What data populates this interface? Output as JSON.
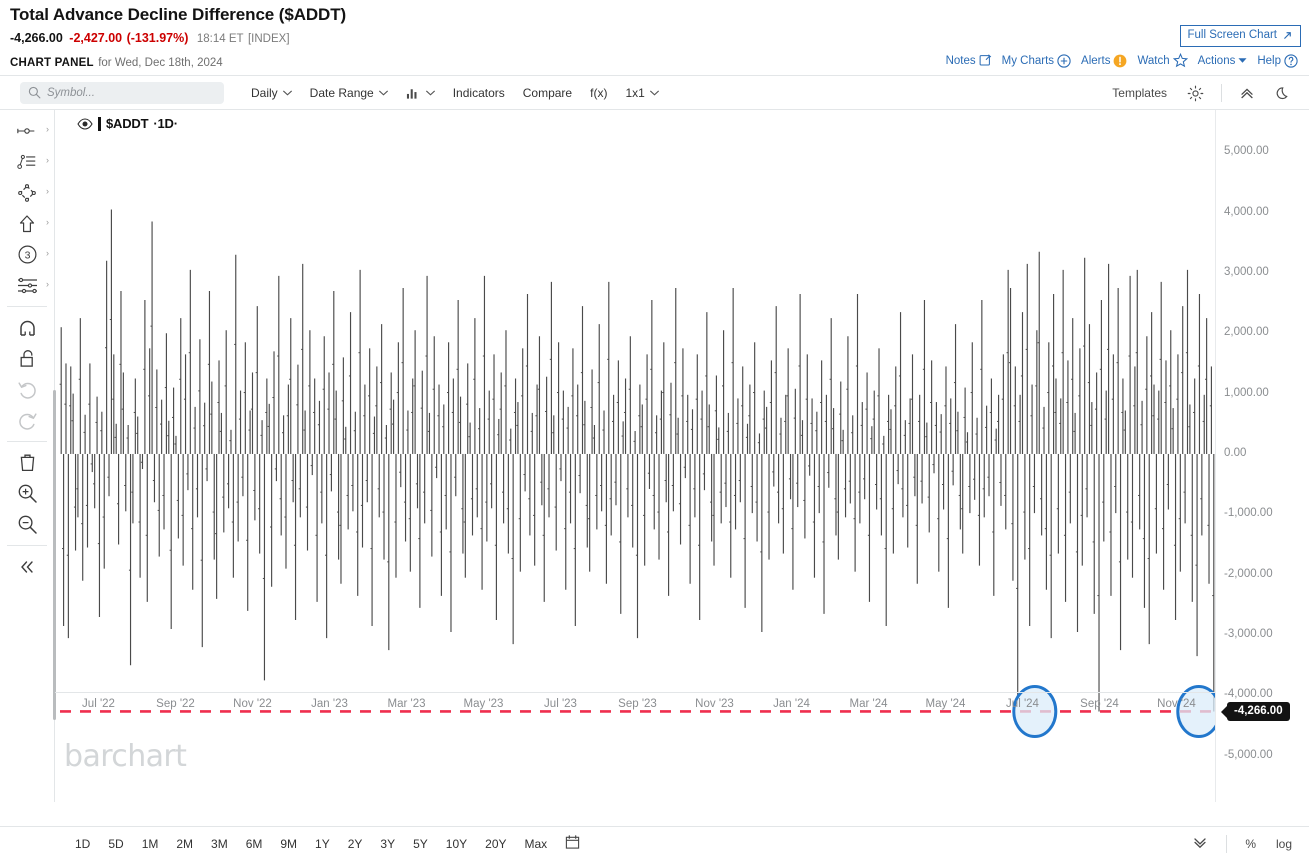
{
  "quote": {
    "title": "Total Advance Decline Difference ($ADDT)",
    "last": "-4,266.00",
    "change": "-2,427.00",
    "change_pct": "(-131.97%)",
    "time": "18:14 ET",
    "exchange": "[INDEX]",
    "change_color": "#cc0000"
  },
  "panel": {
    "label": "CHART PANEL",
    "for_text": " for Wed, Dec 18th, 2024",
    "full_screen_label": "Full Screen Chart",
    "links": [
      {
        "label": "Notes",
        "icon": "note-edit-icon"
      },
      {
        "label": "My Charts",
        "icon": "plus-circle-icon"
      },
      {
        "label": "Alerts",
        "icon": "alert-exclamation-icon"
      },
      {
        "label": "Watch",
        "icon": "star-icon"
      },
      {
        "label": "Actions",
        "icon": "caret-down-icon"
      },
      {
        "label": "Help",
        "icon": "question-circle-icon"
      }
    ]
  },
  "toolbar": {
    "search_placeholder": "Symbol...",
    "search_value": "",
    "items": [
      {
        "label": "Daily",
        "caret": true
      },
      {
        "label": "Date Range",
        "caret": true
      },
      {
        "label": "",
        "icon": "bar-chart-type-icon",
        "caret": true
      },
      {
        "label": "Indicators",
        "caret": false
      },
      {
        "label": "Compare",
        "caret": false
      },
      {
        "label": "f(x)",
        "caret": false
      },
      {
        "label": "1x1",
        "caret": true
      }
    ],
    "right": {
      "templates_label": "Templates",
      "settings_icon": "gear-icon",
      "collapse_icon": "chevron-up-double-icon",
      "theme_icon": "moon-icon"
    }
  },
  "tools": [
    {
      "name": "crosshair-line-tool",
      "icon": "line-dot-icon",
      "expandable": true,
      "dim": false
    },
    {
      "name": "annotation-list-tool",
      "icon": "trendline-list-icon",
      "expandable": true,
      "dim": false
    },
    {
      "name": "shapes-tool",
      "icon": "polygon-icon",
      "expandable": true,
      "dim": false
    },
    {
      "name": "arrow-tool",
      "icon": "arrow-up-icon",
      "expandable": true,
      "dim": false
    },
    {
      "name": "number-marker-tool",
      "icon": "circle-three-icon",
      "expandable": true,
      "dim": false
    },
    {
      "name": "fibonacci-tool",
      "icon": "fib-levels-icon",
      "expandable": true,
      "dim": false
    },
    {
      "name": "magnet-tool",
      "icon": "magnet-icon",
      "expandable": false,
      "dim": false
    },
    {
      "name": "lock-tool",
      "icon": "unlock-icon",
      "expandable": false,
      "dim": false
    },
    {
      "name": "undo-tool",
      "icon": "undo-icon",
      "expandable": false,
      "dim": true
    },
    {
      "name": "redo-tool",
      "icon": "redo-icon",
      "expandable": false,
      "dim": true
    },
    {
      "name": "delete-tool",
      "icon": "trash-icon",
      "expandable": false,
      "dim": false
    },
    {
      "name": "zoom-in-tool",
      "icon": "zoom-in-icon",
      "expandable": false,
      "dim": false
    },
    {
      "name": "zoom-out-tool",
      "icon": "zoom-out-icon",
      "expandable": false,
      "dim": false
    },
    {
      "name": "collapse-sidebar",
      "icon": "chevron-left-double-icon",
      "expandable": false,
      "dim": false
    }
  ],
  "legend": {
    "symbol": "$ADDT",
    "interval": "·1D·",
    "visibility_icon": "eye-icon"
  },
  "watermark": "barchart",
  "ranges": {
    "buttons": [
      "1D",
      "5D",
      "1M",
      "2M",
      "3M",
      "6M",
      "9M",
      "1Y",
      "2Y",
      "3Y",
      "5Y",
      "10Y",
      "20Y",
      "Max"
    ],
    "calendar_icon": "calendar-icon",
    "right": {
      "more_icon": "chevron-down-double-icon",
      "percent_label": "%",
      "log_label": "log"
    }
  },
  "annotations": {
    "price_line": {
      "value": -4266.0,
      "label": "-4,266.00",
      "color": "#ef2e4e",
      "style": "dashed"
    },
    "ellipses": [
      {
        "x_pct": 84.4,
        "value": -4266.0,
        "stroke": "#2277cc",
        "fill": "#dbecf9"
      },
      {
        "x_pct": 98.6,
        "value": -4266.0,
        "stroke": "#2277cc",
        "fill": "#dbecf9"
      }
    ]
  },
  "chart_data": {
    "type": "bar",
    "title": "Total Advance Decline Difference ($ADDT)",
    "subtitle": "$ADDT ·1D·",
    "xlabel": "",
    "ylabel": "",
    "ylim": [
      -5600,
      5400
    ],
    "yticks": [
      5000,
      4000,
      3000,
      2000,
      1000,
      0,
      -1000,
      -2000,
      -3000,
      -4000,
      -5000
    ],
    "ytick_labels": [
      "5,000.00",
      "4,000.00",
      "3,000.00",
      "2,000.00",
      "1,000.00",
      "0.00",
      "-1,000.00",
      "-2,000.00",
      "-3,000.00",
      "-4,000.00",
      "-5,000.00"
    ],
    "xticks": [
      "Jul '22",
      "Sep '22",
      "Nov '22",
      "Jan '23",
      "Mar '23",
      "May '23",
      "Jul '23",
      "Sep '23",
      "Nov '23",
      "Jan '24",
      "Mar '24",
      "May '24",
      "Jul '24",
      "Sep '24",
      "Nov '24"
    ],
    "grid": false,
    "legend_position": "top-left",
    "bar_color": "#4a4a4a",
    "zero_line": 0,
    "last_value": -4266.0,
    "values": [
      2100,
      -2850,
      1500,
      -3050,
      1450,
      1000,
      -1600,
      -1050,
      2250,
      -2100,
      650,
      -1550,
      1500,
      -300,
      -900,
      950,
      -2700,
      700,
      -1900,
      3200,
      -700,
      4050,
      1650,
      500,
      -1500,
      2700,
      1350,
      -950,
      480,
      -3500,
      -1150,
      1250,
      620,
      -2050,
      -250,
      2550,
      -2450,
      1750,
      3850,
      -800,
      1400,
      -1700,
      900,
      -1250,
      2000,
      550,
      -2900,
      1100,
      300,
      -1400,
      2250,
      -1850,
      1650,
      -600,
      3050,
      -2250,
      780,
      -1050,
      1900,
      -3200,
      850,
      -450,
      2700,
      1200,
      -1750,
      -2400,
      1550,
      680,
      -1300,
      2050,
      -900,
      400,
      -2050,
      3300,
      -1450,
      1050,
      -700,
      1850,
      -2600,
      720,
      1350,
      -1100,
      2450,
      -1650,
      560,
      -3750,
      1250,
      830,
      -2200,
      1700,
      -450,
      2950,
      -1350,
      640,
      -1900,
      1150,
      2250,
      -800,
      -2750,
      1480,
      -1050,
      3150,
      720,
      -1600,
      2050,
      -350,
      1250,
      -2450,
      880,
      -1150,
      1950,
      -3050,
      1350,
      -620,
      2700,
      1050,
      -1750,
      -2150,
      1600,
      450,
      -1250,
      2350,
      -950,
      700,
      -2350,
      3050,
      -1550,
      1150,
      -800,
      1750,
      -2850,
      620,
      1450,
      -1050,
      2150,
      -1750,
      480,
      -3250,
      1350,
      900,
      -2050,
      1850,
      -550,
      2750,
      -1450,
      720,
      -1950,
      1250,
      2050,
      -900,
      -2550,
      1380,
      -1150,
      2950,
      680,
      -1700,
      1950,
      -400,
      1150,
      -2350,
      820,
      -1250,
      1850,
      -2950,
      1250,
      -700,
      2550,
      950,
      -1650,
      -2050,
      1500,
      520,
      -1350,
      2250,
      -1050,
      760,
      -2250,
      2950,
      -1450,
      1050,
      -900,
      1650,
      -2750,
      580,
      1350,
      -1150,
      2050,
      -1650,
      420,
      -3150,
      1250,
      860,
      -1950,
      1750,
      -620,
      2650,
      -1350,
      680,
      -1850,
      1150,
      1950,
      -850,
      -2450,
      1280,
      -1050,
      2850,
      640,
      -1600,
      1850,
      -450,
      1050,
      -2250,
      780,
      -1150,
      1750,
      -2850,
      1150,
      -650,
      2450,
      880,
      -1550,
      -1950,
      1400,
      480,
      -1250,
      2150,
      -950,
      720,
      -2150,
      2850,
      -1350,
      980,
      -850,
      1550,
      -2650,
      540,
      1250,
      -1050,
      1950,
      -1550,
      380,
      -3050,
      1150,
      820,
      -1850,
      1650,
      -580,
      2550,
      -1250,
      640,
      -1750,
      1050,
      1850,
      -800,
      -2350,
      1180,
      -950,
      2750,
      600,
      -1500,
      1750,
      -400,
      980,
      -2150,
      740,
      -1050,
      1650,
      -2750,
      1050,
      -600,
      2350,
      820,
      -1450,
      -1850,
      1300,
      440,
      -1150,
      2050,
      -880,
      680,
      -2050,
      2750,
      -1250,
      920,
      -800,
      1450,
      -2550,
      500,
      1150,
      -980,
      1850,
      -1450,
      340,
      -2950,
      1050,
      780,
      -1750,
      1550,
      -540,
      2450,
      -1150,
      600,
      -1650,
      980,
      1750,
      -750,
      -2250,
      1080,
      -880,
      2650,
      560,
      -1400,
      1650,
      -360,
      920,
      -2050,
      700,
      -980,
      1550,
      -2650,
      980,
      -560,
      2250,
      760,
      -1350,
      -1750,
      1200,
      400,
      -1050,
      1950,
      -820,
      640,
      -1950,
      2650,
      -1150,
      860,
      -750,
      1350,
      -2450,
      460,
      1050,
      -920,
      1750,
      -1350,
      300,
      -2850,
      980,
      740,
      -1650,
      1450,
      -500,
      2350,
      -1050,
      560,
      -1550,
      920,
      1650,
      -700,
      -2150,
      980,
      -820,
      2550,
      520,
      -1300,
      1550,
      -320,
      860,
      -1950,
      660,
      -920,
      1450,
      -2550,
      920,
      -520,
      2150,
      700,
      -1250,
      -1650,
      1100,
      360,
      -980,
      1850,
      -760,
      600,
      -1850,
      2550,
      -1050,
      800,
      -700,
      1250,
      -2350,
      420,
      980,
      -860,
      1650,
      -1250,
      3050,
      2750,
      -2100,
      1450,
      -4050,
      980,
      2350,
      -1750,
      3150,
      -2850,
      1150,
      -980,
      2050,
      3350,
      -1350,
      780,
      -2250,
      1850,
      -3050,
      2650,
      1250,
      -1650,
      920,
      3050,
      -2450,
      1550,
      -1150,
      2250,
      680,
      -2950,
      1750,
      -1850,
      3250,
      -1050,
      2150,
      860,
      -2650,
      1350,
      -4266,
      2550,
      -1450,
      1050,
      3150,
      -2350,
      1650,
      -980,
      2750,
      -3250,
      1250,
      720,
      -1750,
      2950,
      -2050,
      1450,
      3050,
      -1250,
      880,
      -2550,
      1950,
      -3150,
      2350,
      1150,
      -1650,
      1050,
      2850,
      -2250,
      1550,
      -920,
      2050,
      760,
      -2750,
      1650,
      -1950,
      2450,
      -1150,
      3050,
      820,
      -2450,
      1250,
      -3350,
      2650,
      -1350,
      980,
      2250,
      -2150,
      1450,
      -4266
    ]
  }
}
